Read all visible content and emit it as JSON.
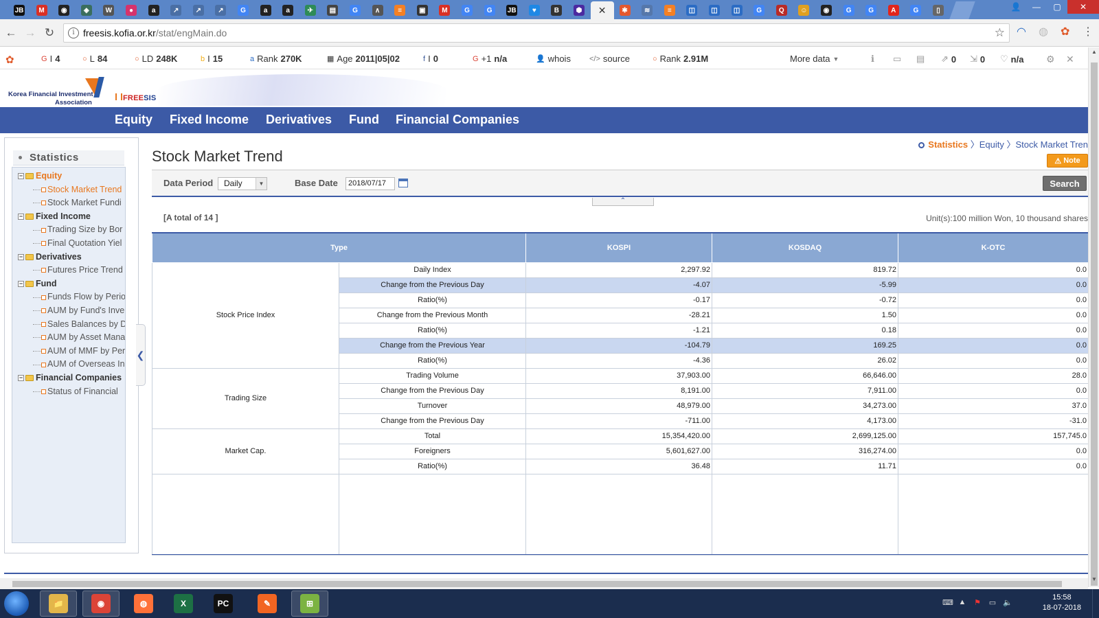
{
  "browser": {
    "tabs_favicons": [
      {
        "name": "jb-icon",
        "glyph": "JB",
        "color": "#111111"
      },
      {
        "name": "gmail-icon",
        "glyph": "M",
        "color": "#d93025"
      },
      {
        "name": "github-icon",
        "glyph": "◉",
        "color": "#222222"
      },
      {
        "name": "diamond-icon",
        "glyph": "◈",
        "color": "#3a6e5e"
      },
      {
        "name": "wikipedia-icon",
        "glyph": "W",
        "color": "#555555"
      },
      {
        "name": "pink-circle-icon",
        "glyph": "●",
        "color": "#d6336c"
      },
      {
        "name": "amazon-icon",
        "glyph": "a",
        "color": "#222222"
      },
      {
        "name": "chart-icon",
        "glyph": "↗",
        "color": "#4a6fa5"
      },
      {
        "name": "chart-icon",
        "glyph": "↗",
        "color": "#4a6fa5"
      },
      {
        "name": "chart-icon",
        "glyph": "↗",
        "color": "#4a6fa5"
      },
      {
        "name": "google-icon",
        "glyph": "G",
        "color": "#4285f4"
      },
      {
        "name": "amazon-icon",
        "glyph": "a",
        "color": "#222222"
      },
      {
        "name": "amazon-icon",
        "glyph": "a",
        "color": "#222222"
      },
      {
        "name": "bird-icon",
        "glyph": "✈",
        "color": "#2e8b57"
      },
      {
        "name": "reader-icon",
        "glyph": "▤",
        "color": "#444444"
      },
      {
        "name": "google-icon",
        "glyph": "G",
        "color": "#4285f4"
      },
      {
        "name": "wave-icon",
        "glyph": "∧",
        "color": "#555555"
      },
      {
        "name": "stack-icon",
        "glyph": "≡",
        "color": "#f48024"
      },
      {
        "name": "monitor-icon",
        "glyph": "▣",
        "color": "#333333"
      },
      {
        "name": "gmail-icon",
        "glyph": "M",
        "color": "#d93025"
      },
      {
        "name": "google-icon",
        "glyph": "G",
        "color": "#4285f4"
      },
      {
        "name": "google-icon",
        "glyph": "G",
        "color": "#4285f4"
      },
      {
        "name": "jb-icon",
        "glyph": "JB",
        "color": "#111111"
      },
      {
        "name": "heart-icon",
        "glyph": "♥",
        "color": "#1e88e5"
      },
      {
        "name": "b-icon",
        "glyph": "B",
        "color": "#333333"
      },
      {
        "name": "hex-icon",
        "glyph": "⬢",
        "color": "#4b2aa0"
      }
    ],
    "active_tab_close": "✕",
    "tabs_after_favicons": [
      {
        "name": "figure-icon",
        "glyph": "✱",
        "color": "#e4572e"
      },
      {
        "name": "stack-icon",
        "glyph": "≋",
        "color": "#5577aa"
      },
      {
        "name": "stack-icon",
        "glyph": "≡",
        "color": "#f48024"
      },
      {
        "name": "blue-box-icon",
        "glyph": "◫",
        "color": "#2b6cc4"
      },
      {
        "name": "blue-box-icon",
        "glyph": "◫",
        "color": "#2b6cc4"
      },
      {
        "name": "blue-box-icon",
        "glyph": "◫",
        "color": "#2b6cc4"
      },
      {
        "name": "google-icon",
        "glyph": "G",
        "color": "#4285f4"
      },
      {
        "name": "quora-icon",
        "glyph": "Q",
        "color": "#b92b27"
      },
      {
        "name": "face-icon",
        "glyph": "☺",
        "color": "#e0a020"
      },
      {
        "name": "github-icon",
        "glyph": "◉",
        "color": "#222222"
      },
      {
        "name": "google-icon",
        "glyph": "G",
        "color": "#4285f4"
      },
      {
        "name": "google-icon",
        "glyph": "G",
        "color": "#4285f4"
      },
      {
        "name": "adobe-icon",
        "glyph": "A",
        "color": "#e1251b"
      },
      {
        "name": "google-icon",
        "glyph": "G",
        "color": "#4285f4"
      },
      {
        "name": "document-icon",
        "glyph": "▯",
        "color": "#666666"
      }
    ],
    "url_host": "freesis.kofia.or.kr",
    "url_path": "/stat/engMain.do",
    "window_controls": {
      "minimize": "—",
      "maximize": "▢",
      "close": "✕",
      "user": "👤"
    }
  },
  "seobar": {
    "items": [
      {
        "name": "google-index",
        "icon": "G",
        "label": "I",
        "value": "4",
        "color": "#db4437"
      },
      {
        "name": "links",
        "icon": "○",
        "label": "L",
        "value": "84",
        "color": "#e05a2a"
      },
      {
        "name": "linking-domains",
        "icon": "○",
        "label": "LD",
        "value": "248K",
        "color": "#e05a2a"
      },
      {
        "name": "bing-index",
        "icon": "b",
        "label": "I",
        "value": "15",
        "color": "#f2b01e"
      },
      {
        "name": "alexa-rank",
        "icon": "a",
        "label": "Rank",
        "value": "270K",
        "color": "#2b6cc4"
      },
      {
        "name": "domain-age",
        "icon": "▦",
        "label": "Age",
        "value": "2011|05|02",
        "color": "#333333"
      },
      {
        "name": "facebook-likes",
        "icon": "f",
        "label": "I",
        "value": "0",
        "color": "#3b5998"
      },
      {
        "name": "google-plus",
        "icon": "G",
        "label": "+1",
        "value": "n/a",
        "color": "#db4437"
      },
      {
        "name": "whois",
        "icon": "👤",
        "label": "whois",
        "value": "",
        "color": "#777777"
      },
      {
        "name": "source",
        "icon": "</>",
        "label": "source",
        "value": "",
        "color": "#777777"
      },
      {
        "name": "semrush-rank",
        "icon": "○",
        "label": "Rank",
        "value": "2.91M",
        "color": "#e05a2a"
      }
    ],
    "more_data": "More data",
    "right_items": [
      {
        "name": "info",
        "icon": "ℹ",
        "value": ""
      },
      {
        "name": "display",
        "icon": "▭",
        "value": ""
      },
      {
        "name": "page",
        "icon": "▤",
        "value": ""
      },
      {
        "name": "external-links",
        "icon": "⇗",
        "value": "0"
      },
      {
        "name": "internal-links",
        "icon": "⇲",
        "value": "0"
      },
      {
        "name": "heart",
        "icon": "♡",
        "value": "n/a"
      }
    ]
  },
  "site": {
    "org_line1": "Korea Financial Investment",
    "org_line2": "Association",
    "brand_free": "FREE",
    "brand_sis": "SIS",
    "nav": [
      "Equity",
      "Fixed Income",
      "Derivatives",
      "Fund",
      "Financial Companies"
    ]
  },
  "sidebar": {
    "title": "Statistics",
    "tree": [
      {
        "type": "cat",
        "label": "Equity",
        "active": true
      },
      {
        "type": "leaf",
        "label": "Stock Market Trend",
        "active": true
      },
      {
        "type": "leaf",
        "label": "Stock Market Fundi",
        "active": false
      },
      {
        "type": "cat",
        "label": "Fixed Income",
        "active": false
      },
      {
        "type": "leaf",
        "label": "Trading Size by Bor",
        "active": false
      },
      {
        "type": "leaf",
        "label": "Final Quotation Yiel",
        "active": false
      },
      {
        "type": "cat",
        "label": "Derivatives",
        "active": false
      },
      {
        "type": "leaf",
        "label": "Futures Price Trend",
        "active": false
      },
      {
        "type": "cat",
        "label": "Fund",
        "active": false
      },
      {
        "type": "leaf",
        "label": "Funds Flow by Perio",
        "active": false
      },
      {
        "type": "leaf",
        "label": "AUM by Fund's Inve",
        "active": false
      },
      {
        "type": "leaf",
        "label": "Sales Balances by D",
        "active": false
      },
      {
        "type": "leaf",
        "label": "AUM by Asset Mana",
        "active": false
      },
      {
        "type": "leaf",
        "label": "AUM of MMF by Per",
        "active": false
      },
      {
        "type": "leaf",
        "label": "AUM of Overseas In",
        "active": false
      },
      {
        "type": "cat",
        "label": "Financial Companies",
        "active": false
      },
      {
        "type": "leaf",
        "label": "Status of Financial",
        "active": false
      }
    ]
  },
  "content": {
    "title": "Stock Market Trend",
    "breadcrumb": [
      "Statistics",
      "Equity",
      "Stock Market Tren"
    ],
    "note": "Note",
    "filter": {
      "period_label": "Data Period",
      "period_value": "Daily",
      "base_date_label": "Base Date",
      "base_date_value": "2018/07/17",
      "search": "Search"
    },
    "total": "[A total of 14 ]",
    "unit": "Unit(s):100 million Won, 10 thousand shares",
    "table": {
      "headers": [
        "Type",
        "KOSPI",
        "KOSDAQ",
        "K-OTC"
      ],
      "groups": [
        {
          "label": "Stock Price Index",
          "rows": [
            {
              "item": "Daily Index",
              "kospi": "2,297.92",
              "kosdaq": "819.72",
              "kotc": "0.0",
              "hl": false
            },
            {
              "item": "Change from  the Previous Day",
              "kospi": "-4.07",
              "kosdaq": "-5.99",
              "kotc": "0.0",
              "hl": true
            },
            {
              "item": "Ratio(%)",
              "kospi": "-0.17",
              "kosdaq": "-0.72",
              "kotc": "0.0",
              "hl": false
            },
            {
              "item": "Change from  the Previous Month",
              "kospi": "-28.21",
              "kosdaq": "1.50",
              "kotc": "0.0",
              "hl": false
            },
            {
              "item": "Ratio(%)",
              "kospi": "-1.21",
              "kosdaq": "0.18",
              "kotc": "0.0",
              "hl": false
            },
            {
              "item": "Change from  the Previous Year",
              "kospi": "-104.79",
              "kosdaq": "169.25",
              "kotc": "0.0",
              "hl": true
            },
            {
              "item": "Ratio(%)",
              "kospi": "-4.36",
              "kosdaq": "26.02",
              "kotc": "0.0",
              "hl": false
            }
          ]
        },
        {
          "label": "Trading Size",
          "rows": [
            {
              "item": "Trading Volume",
              "kospi": "37,903.00",
              "kosdaq": "66,646.00",
              "kotc": "28.0",
              "hl": false
            },
            {
              "item": "Change from  the Previous Day",
              "kospi": "8,191.00",
              "kosdaq": "7,911.00",
              "kotc": "0.0",
              "hl": false
            },
            {
              "item": "Turnover",
              "kospi": "48,979.00",
              "kosdaq": "34,273.00",
              "kotc": "37.0",
              "hl": false
            },
            {
              "item": "Change from  the Previous Day",
              "kospi": "-711.00",
              "kosdaq": "4,173.00",
              "kotc": "-31.0",
              "hl": false
            }
          ]
        },
        {
          "label": "Market Cap.",
          "rows": [
            {
              "item": "Total",
              "kospi": "15,354,420.00",
              "kosdaq": "2,699,125.00",
              "kotc": "157,745.0",
              "hl": false
            },
            {
              "item": "Foreigners",
              "kospi": "5,601,627.00",
              "kosdaq": "316,274.00",
              "kotc": "0.0",
              "hl": false
            },
            {
              "item": "Ratio(%)",
              "kospi": "36.48",
              "kosdaq": "11.71",
              "kotc": "0.0",
              "hl": false
            }
          ]
        }
      ]
    }
  },
  "taskbar": {
    "apps": [
      {
        "name": "explorer",
        "label": "📁",
        "color": "#e3b64a",
        "open": true
      },
      {
        "name": "chrome",
        "label": "◉",
        "color": "#db4437",
        "open": true
      },
      {
        "name": "firefox",
        "label": "◍",
        "color": "#ff7139",
        "open": false
      },
      {
        "name": "excel",
        "label": "X",
        "color": "#1d7044",
        "open": false
      },
      {
        "name": "pycharm",
        "label": "PC",
        "color": "#111111",
        "open": false
      },
      {
        "name": "pen-app",
        "label": "✎",
        "color": "#f26522",
        "open": false
      },
      {
        "name": "terminal-app",
        "label": "⊞",
        "color": "#7cb342",
        "open": true
      }
    ],
    "time": "15:58",
    "date": "18-07-2018"
  }
}
